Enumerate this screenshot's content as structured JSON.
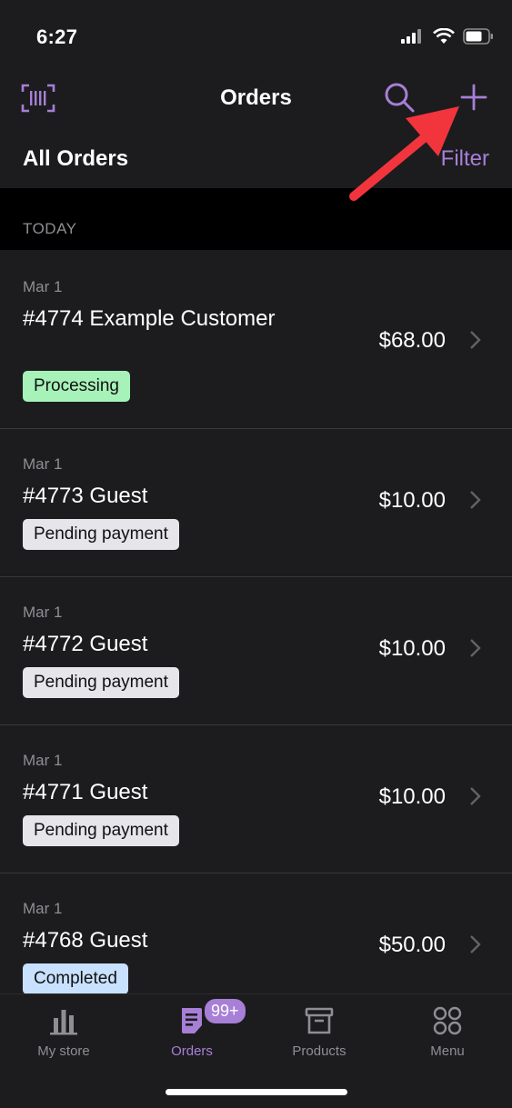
{
  "status": {
    "time": "6:27"
  },
  "nav": {
    "title": "Orders",
    "icons": {
      "left": "barcode-scanner-icon",
      "search": "search-icon",
      "add": "plus-icon"
    }
  },
  "subheader": {
    "title": "All Orders",
    "filter_label": "Filter"
  },
  "section": {
    "label": "TODAY"
  },
  "orders": [
    {
      "date": "Mar 1",
      "title": "#4774 Example Customer",
      "total": "$68.00",
      "status": "Processing",
      "status_color": "#a6f2b9"
    },
    {
      "date": "Mar 1",
      "title": "#4773 Guest",
      "total": "$10.00",
      "status": "Pending payment",
      "status_color": "#e5e5ea"
    },
    {
      "date": "Mar 1",
      "title": "#4772 Guest",
      "total": "$10.00",
      "status": "Pending payment",
      "status_color": "#e5e5ea"
    },
    {
      "date": "Mar 1",
      "title": "#4771 Guest",
      "total": "$10.00",
      "status": "Pending payment",
      "status_color": "#e5e5ea"
    },
    {
      "date": "Mar 1",
      "title": "#4768 Guest",
      "total": "$50.00",
      "status": "Completed",
      "status_color": "#c8e1ff"
    }
  ],
  "tabs": [
    {
      "label": "My store",
      "icon": "bar-chart-icon"
    },
    {
      "label": "Orders",
      "icon": "orders-icon",
      "badge": "99+"
    },
    {
      "label": "Products",
      "icon": "archive-box-icon"
    },
    {
      "label": "Menu",
      "icon": "grid-circles-icon"
    }
  ],
  "colors": {
    "accent": "#a77fd6",
    "background": "#1c1c1e",
    "arrow": "#f2353d"
  }
}
